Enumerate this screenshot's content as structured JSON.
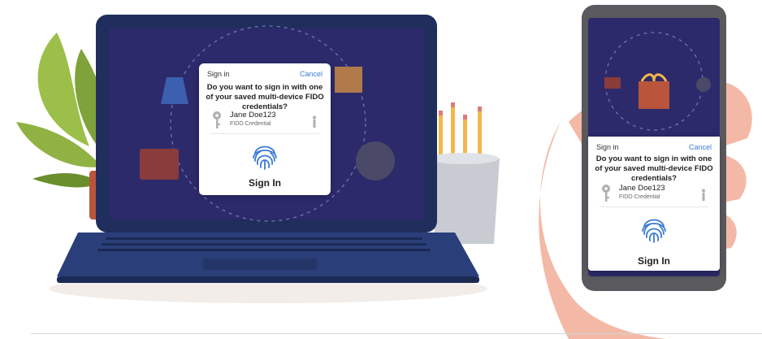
{
  "laptop_dialog": {
    "title": "Sign in",
    "cancel_label": "Cancel",
    "question": "Do you want to sign in with one of your saved multi-device FIDO credentials?",
    "credential_name": "Jane Doe123",
    "credential_type": "FIDO Credential",
    "signin_label": "Sign In"
  },
  "phone_dialog": {
    "title": "Sign in",
    "cancel_label": "Cancel",
    "question": "Do you want to sign in with one of your saved multi-device FIDO credentials?",
    "credential_name": "Jane Doe123",
    "credential_type": "FIDO Credential",
    "signin_label": "Sign In"
  },
  "colors": {
    "screen_bg": "#2c2a6b",
    "laptop_frame": "#1f2e5c",
    "keyboard_base": "#2a3f7a",
    "fingerprint": "#3a7bd5",
    "link": "#3a7bd5",
    "plant": "#7fa33a",
    "pencil_cup": "#c8ccd2",
    "hand": "#f4b9a6"
  },
  "icons": {
    "key": "key-icon",
    "person": "person-icon",
    "fingerprint": "fingerprint-icon"
  }
}
